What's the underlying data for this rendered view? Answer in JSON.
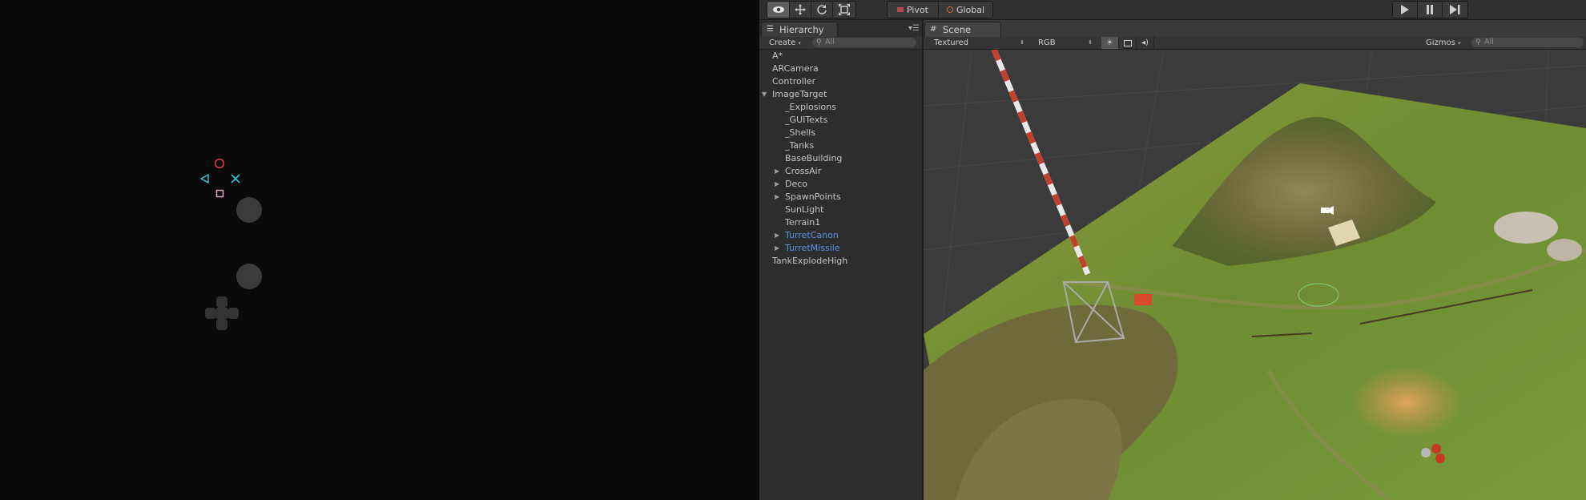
{
  "controller": {
    "circle_color": "#d9334a",
    "triangle_color": "#33c2cf",
    "cross_color": "#33c2cf",
    "square_color": "#e0a0c8"
  },
  "toolbar": {
    "tools": [
      "hand-icon",
      "move-icon",
      "rotate-icon",
      "scale-icon"
    ],
    "pivot_label": "Pivot",
    "global_label": "Global",
    "play_controls": [
      "play-icon",
      "pause-icon",
      "step-icon"
    ]
  },
  "hierarchy": {
    "tab_label": "Hierarchy",
    "create_label": "Create",
    "search_placeholder": "All",
    "items": [
      {
        "label": "A*",
        "indent": 0,
        "arrow": "",
        "prefab": false
      },
      {
        "label": "ARCamera",
        "indent": 0,
        "arrow": "",
        "prefab": false
      },
      {
        "label": "Controller",
        "indent": 0,
        "arrow": "",
        "prefab": false
      },
      {
        "label": "ImageTarget",
        "indent": 0,
        "arrow": "down",
        "prefab": false
      },
      {
        "label": "_Explosions",
        "indent": 1,
        "arrow": "",
        "prefab": false
      },
      {
        "label": "_GUITexts",
        "indent": 1,
        "arrow": "",
        "prefab": false
      },
      {
        "label": "_Shells",
        "indent": 1,
        "arrow": "",
        "prefab": false
      },
      {
        "label": "_Tanks",
        "indent": 1,
        "arrow": "",
        "prefab": false
      },
      {
        "label": "BaseBuilding",
        "indent": 1,
        "arrow": "",
        "prefab": false
      },
      {
        "label": "CrossAir",
        "indent": 1,
        "arrow": "right",
        "prefab": false
      },
      {
        "label": "Deco",
        "indent": 1,
        "arrow": "right",
        "prefab": false
      },
      {
        "label": "SpawnPoints",
        "indent": 1,
        "arrow": "right",
        "prefab": false
      },
      {
        "label": "SunLight",
        "indent": 1,
        "arrow": "",
        "prefab": false
      },
      {
        "label": "Terrain1",
        "indent": 1,
        "arrow": "",
        "prefab": false
      },
      {
        "label": "TurretCanon",
        "indent": 1,
        "arrow": "right",
        "prefab": true
      },
      {
        "label": "TurretMissile",
        "indent": 1,
        "arrow": "right",
        "prefab": true
      },
      {
        "label": "TankExplodeHigh",
        "indent": 0,
        "arrow": "",
        "prefab": false
      }
    ]
  },
  "scene": {
    "tab_label": "Scene",
    "render_mode": "Textured",
    "channel": "RGB",
    "gizmos_label": "Gizmos",
    "search_placeholder": "All"
  }
}
